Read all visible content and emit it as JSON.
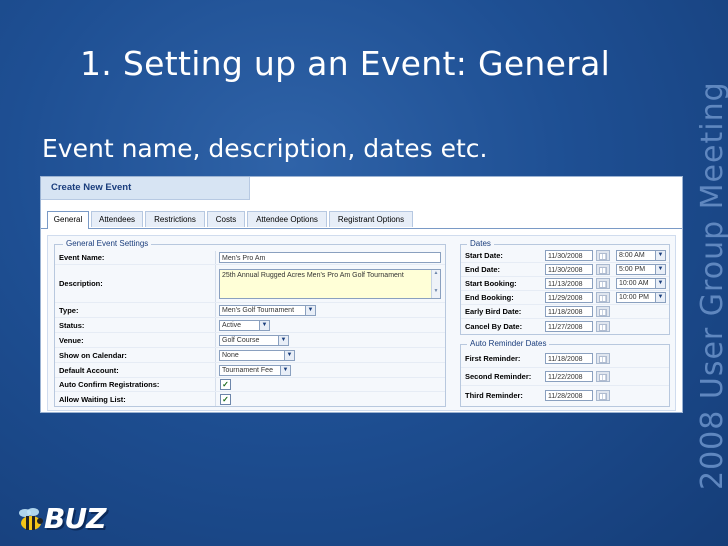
{
  "slide": {
    "title": "1.  Setting up an Event: General",
    "subtitle": "Event name, description, dates etc.",
    "side_text": "2008 User Group Meeting",
    "logo_text": "BUZ"
  },
  "panel": {
    "title": "Create New Event",
    "tabs": [
      {
        "label": "General",
        "active": true
      },
      {
        "label": "Attendees"
      },
      {
        "label": "Restrictions"
      },
      {
        "label": "Costs"
      },
      {
        "label": "Attendee Options"
      },
      {
        "label": "Registrant Options"
      }
    ]
  },
  "general": {
    "legend": "General Event Settings",
    "event_name_label": "Event Name:",
    "event_name_value": "Men's Pro Am",
    "description_label": "Description:",
    "description_value": "25th Annual Rugged Acres Men's Pro Am Golf Tournament",
    "type_label": "Type:",
    "type_value": "Men's Golf Tournament",
    "status_label": "Status:",
    "status_value": "Active",
    "venue_label": "Venue:",
    "venue_value": "Golf Course",
    "calendar_label": "Show on Calendar:",
    "calendar_value": "None",
    "account_label": "Default Account:",
    "account_value": "Tournament Fee",
    "auto_confirm_label": "Auto Confirm Registrations:",
    "auto_confirm_checked": true,
    "waiting_list_label": "Allow Waiting List:",
    "waiting_list_checked": true
  },
  "dates": {
    "legend": "Dates",
    "start_date_label": "Start Date:",
    "start_date_value": "11/30/2008",
    "start_time_value": "8:00 AM",
    "end_date_label": "End Date:",
    "end_date_value": "11/30/2008",
    "end_time_value": "5:00 PM",
    "start_booking_label": "Start Booking:",
    "start_booking_value": "11/13/2008",
    "start_booking_time": "10:00 AM",
    "end_booking_label": "End Booking:",
    "end_booking_value": "11/29/2008",
    "end_booking_time": "10:00 PM",
    "early_bird_label": "Early Bird Date:",
    "early_bird_value": "11/18/2008",
    "cancel_label": "Cancel By Date:",
    "cancel_value": "11/27/2008"
  },
  "reminders": {
    "legend": "Auto Reminder Dates",
    "first_label": "First Reminder:",
    "first_value": "11/18/2008",
    "second_label": "Second Reminder:",
    "second_value": "11/22/2008",
    "third_label": "Third Reminder:",
    "third_value": "11/28/2008"
  }
}
